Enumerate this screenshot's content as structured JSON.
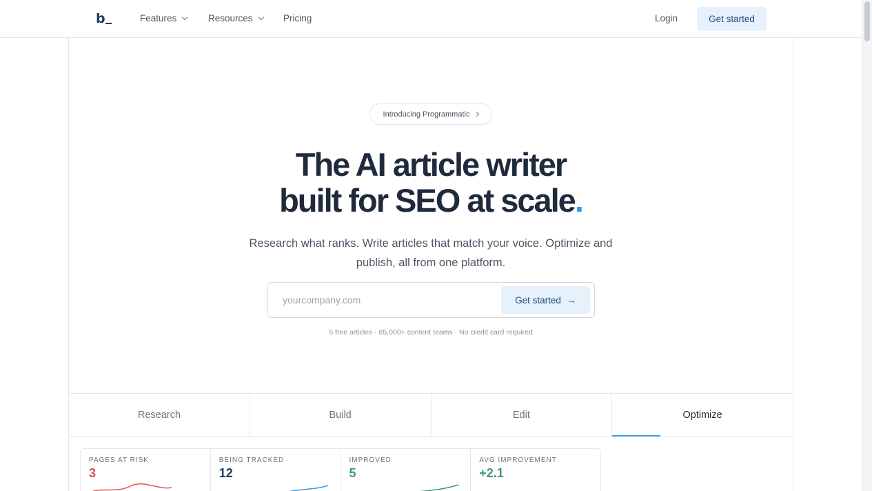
{
  "nav": {
    "logo": "b",
    "features": "Features",
    "resources": "Resources",
    "pricing": "Pricing",
    "login": "Login",
    "cta": "Get started"
  },
  "hero": {
    "pill": "Introducing Programmatic",
    "title_line1": "The AI article writer",
    "title_line2": "built for SEO at scale",
    "title_dot": ".",
    "subtitle": "Research what ranks. Write articles that match your voice. Optimize and publish, all from one platform.",
    "input_placeholder": "yourcompany.com",
    "button": "Get started",
    "fineprint": "5 free articles · 85,000+ content teams · No credit card required"
  },
  "tabs": [
    {
      "label": "Research",
      "active": false
    },
    {
      "label": "Build",
      "active": false
    },
    {
      "label": "Edit",
      "active": false
    },
    {
      "label": "Optimize",
      "active": true
    }
  ],
  "stats": [
    {
      "label": "PAGES AT RISK",
      "value": "3",
      "color": "#d9534f"
    },
    {
      "label": "BEING TRACKED",
      "value": "12",
      "color": "#1f3a5c"
    },
    {
      "label": "IMPROVED",
      "value": "5",
      "color": "#3f9a72"
    },
    {
      "label": "AVG IMPROVEMENT",
      "value": "+2.1",
      "color": "#3f9a72"
    }
  ],
  "colors": {
    "accent": "#3b9ae1",
    "cta_bg": "#e6f1fb",
    "cta_text": "#1e4d80"
  }
}
